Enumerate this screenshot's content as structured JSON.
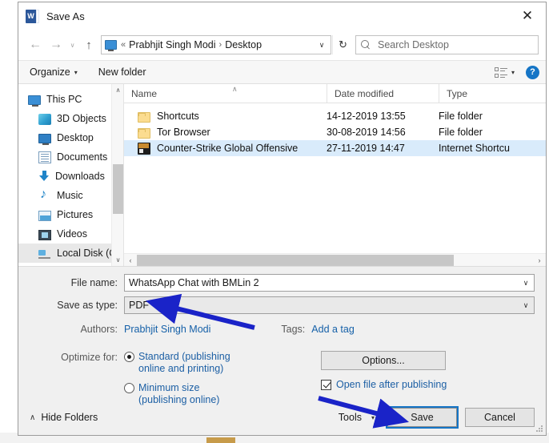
{
  "window": {
    "title": "Save As",
    "app_icon": "word-icon",
    "close_label": "✕"
  },
  "nav": {
    "back_icon": "←",
    "forward_icon": "→",
    "recent_caret": "∨",
    "up_icon": "↑",
    "breadcrumb": {
      "root_icon": "monitor-icon",
      "overflow": "«",
      "items": [
        "Prabhjit Singh Modi",
        "Desktop"
      ],
      "separator": "›",
      "caret": "∨"
    },
    "refresh_icon": "↻",
    "search": {
      "placeholder": "Search Desktop",
      "value": ""
    }
  },
  "toolbar": {
    "organize_label": "Organize",
    "organize_caret": "▾",
    "new_folder_label": "New folder",
    "view_caret": "▾",
    "help_label": "?"
  },
  "navpane": {
    "items": [
      {
        "label": "This PC",
        "icon": "pc-icon",
        "indent": false,
        "selected": false
      },
      {
        "label": "3D Objects",
        "icon": "3d-objects-icon",
        "indent": true,
        "selected": false
      },
      {
        "label": "Desktop",
        "icon": "desktop-icon",
        "indent": true,
        "selected": false
      },
      {
        "label": "Documents",
        "icon": "documents-icon",
        "indent": true,
        "selected": false
      },
      {
        "label": "Downloads",
        "icon": "downloads-icon",
        "indent": true,
        "selected": false
      },
      {
        "label": "Music",
        "icon": "music-icon",
        "indent": true,
        "selected": false
      },
      {
        "label": "Pictures",
        "icon": "pictures-icon",
        "indent": true,
        "selected": false
      },
      {
        "label": "Videos",
        "icon": "videos-icon",
        "indent": true,
        "selected": false
      },
      {
        "label": "Local Disk (C:)",
        "icon": "disk-icon",
        "indent": true,
        "selected": true
      }
    ],
    "scroll_up_icon": "∧",
    "scroll_down_icon": "∨"
  },
  "filelist": {
    "columns": [
      "Name",
      "Date modified",
      "Type"
    ],
    "sort_indicator": "∧",
    "rows": [
      {
        "name": "Shortcuts",
        "date_modified": "14-12-2019 13:55",
        "type": "File folder",
        "icon": "folder-icon",
        "selected": false
      },
      {
        "name": "Tor Browser",
        "date_modified": "30-08-2019 14:56",
        "type": "File folder",
        "icon": "folder-icon",
        "selected": false
      },
      {
        "name": "Counter-Strike Global Offensive",
        "date_modified": "27-11-2019 14:47",
        "type": "Internet Shortcu",
        "icon": "csgo-shortcut-icon",
        "selected": true
      }
    ],
    "hscroll_left_icon": "‹",
    "hscroll_right_icon": "›"
  },
  "form": {
    "file_name_label": "File name:",
    "file_name_value": "WhatsApp Chat with BMLin 2",
    "save_as_type_label": "Save as type:",
    "save_as_type_value": "PDF",
    "combo_caret": "∨",
    "authors_label": "Authors:",
    "authors_value": "Prabhjit Singh Modi",
    "tags_label": "Tags:",
    "tags_value": "Add a tag"
  },
  "optimize": {
    "label": "Optimize for:",
    "options": [
      {
        "line1": "Standard (publishing",
        "line2": "online and printing)",
        "selected": true
      },
      {
        "line1": "Minimum size",
        "line2": "(publishing online)",
        "selected": false
      }
    ]
  },
  "actions": {
    "options_button": "Options...",
    "open_after_publishing_label": "Open file after publishing",
    "open_after_publishing_checked": true,
    "hide_folders_label": "Hide Folders",
    "hide_folders_caret": "∧",
    "tools_label": "Tools",
    "tools_caret": "▾",
    "save_label": "Save",
    "cancel_label": "Cancel"
  },
  "colors": {
    "accent_blue": "#1575c6",
    "link_blue": "#1c5fa4",
    "selection_blue": "#d9ebfb",
    "word_blue": "#2b579a",
    "annotation_arrow": "#1a23c8",
    "dialog_bg": "#f0f0f0"
  },
  "annotations": [
    {
      "name": "arrow-to-save-as-type",
      "direction": "up-left",
      "target": "Save as type combo box"
    },
    {
      "name": "arrow-to-save-button",
      "direction": "down-right",
      "target": "Save button"
    }
  ]
}
